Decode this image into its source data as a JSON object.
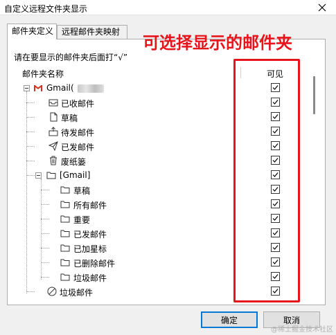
{
  "window": {
    "title": "自定义远程文件夹显示",
    "close_icon": "close-icon"
  },
  "tabs": [
    {
      "label": "邮件夹定义",
      "active": true
    },
    {
      "label": "远程邮件夹映射",
      "active": false
    }
  ],
  "annotation": {
    "text": "可选择显示的邮件夹",
    "color": "#e8141c"
  },
  "instruction": "请在要显示的邮件夹后面打“√”",
  "list": {
    "header_name": "邮件夹名称",
    "header_visible": "可见",
    "rows": [
      {
        "label": "Gmail(",
        "icon": "gmail-icon",
        "checked": true
      },
      {
        "label": "已收邮件",
        "icon": "inbox-icon",
        "checked": true
      },
      {
        "label": "草稿",
        "icon": "draft-icon",
        "checked": true
      },
      {
        "label": "待发邮件",
        "icon": "outbox-icon",
        "checked": true
      },
      {
        "label": "已发邮件",
        "icon": "sent-icon",
        "checked": true
      },
      {
        "label": "废纸篓",
        "icon": "trash-icon",
        "checked": true
      },
      {
        "label": "[Gmail]",
        "icon": "folder-icon",
        "checked": true
      },
      {
        "label": "草稿",
        "icon": "folder-icon",
        "checked": true
      },
      {
        "label": "所有邮件",
        "icon": "folder-icon",
        "checked": true
      },
      {
        "label": "重要",
        "icon": "folder-icon",
        "checked": true
      },
      {
        "label": "已发邮件",
        "icon": "folder-icon",
        "checked": true
      },
      {
        "label": "已加星标",
        "icon": "folder-icon",
        "checked": true
      },
      {
        "label": "已删除邮件",
        "icon": "folder-icon",
        "checked": true
      },
      {
        "label": "垃圾邮件",
        "icon": "folder-icon",
        "checked": true
      },
      {
        "label": "垃圾邮件",
        "icon": "spam-icon",
        "checked": true
      }
    ]
  },
  "buttons": {
    "ok": "确定",
    "cancel": "取消"
  },
  "watermark": "@稀土掘金技术社区"
}
